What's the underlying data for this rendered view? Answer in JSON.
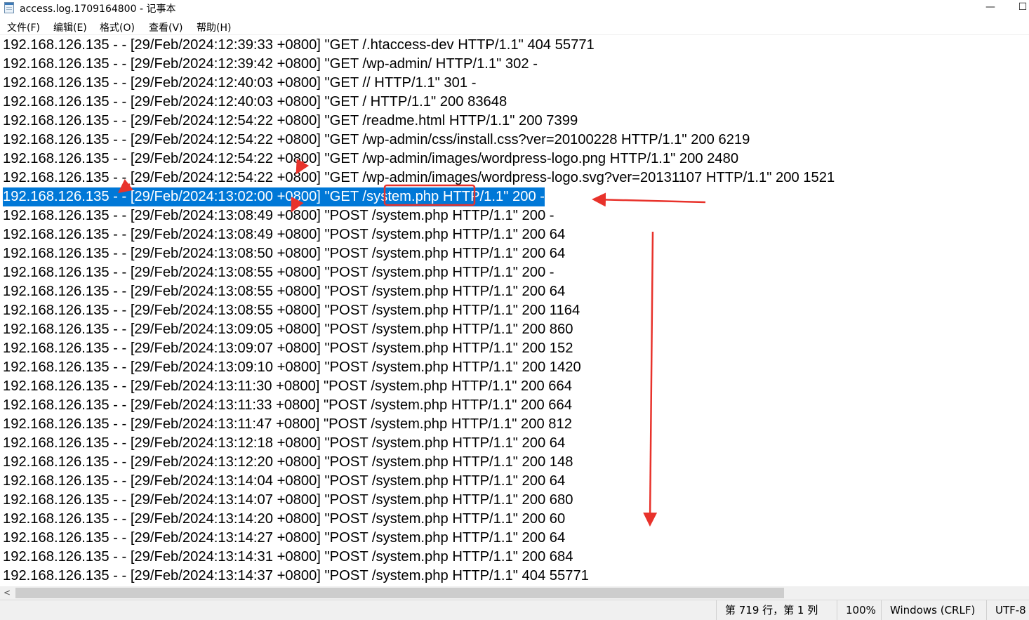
{
  "window": {
    "title": "access.log.1709164800 - 记事本",
    "minimize_label": "—",
    "maximize_label": "☐"
  },
  "menu": [
    "文件(F)",
    "编辑(E)",
    "格式(O)",
    "查看(V)",
    "帮助(H)"
  ],
  "lines": [
    "192.168.126.135 - - [29/Feb/2024:12:39:33 +0800] \"GET /.htaccess-dev HTTP/1.1\" 404 55771",
    "192.168.126.135 - - [29/Feb/2024:12:39:42 +0800] \"GET /wp-admin/ HTTP/1.1\" 302 -",
    "192.168.126.135 - - [29/Feb/2024:12:40:03 +0800] \"GET // HTTP/1.1\" 301 -",
    "192.168.126.135 - - [29/Feb/2024:12:40:03 +0800] \"GET / HTTP/1.1\" 200 83648",
    "192.168.126.135 - - [29/Feb/2024:12:54:22 +0800] \"GET /readme.html HTTP/1.1\" 200 7399",
    "192.168.126.135 - - [29/Feb/2024:12:54:22 +0800] \"GET /wp-admin/css/install.css?ver=20100228 HTTP/1.1\" 200 6219",
    "192.168.126.135 - - [29/Feb/2024:12:54:22 +0800] \"GET /wp-admin/images/wordpress-logo.png HTTP/1.1\" 200 2480",
    "192.168.126.135 - - [29/Feb/2024:12:54:22 +0800] \"GET /wp-admin/images/wordpress-logo.svg?ver=20131107 HTTP/1.1\" 200 1521",
    "192.168.126.135 - - [29/Feb/2024:13:02:00 +0800] \"GET /system.php HTTP/1.1\" 200 -",
    "192.168.126.135 - - [29/Feb/2024:13:08:49 +0800] \"POST /system.php HTTP/1.1\" 200 -",
    "192.168.126.135 - - [29/Feb/2024:13:08:49 +0800] \"POST /system.php HTTP/1.1\" 200 64",
    "192.168.126.135 - - [29/Feb/2024:13:08:50 +0800] \"POST /system.php HTTP/1.1\" 200 64",
    "192.168.126.135 - - [29/Feb/2024:13:08:55 +0800] \"POST /system.php HTTP/1.1\" 200 -",
    "192.168.126.135 - - [29/Feb/2024:13:08:55 +0800] \"POST /system.php HTTP/1.1\" 200 64",
    "192.168.126.135 - - [29/Feb/2024:13:08:55 +0800] \"POST /system.php HTTP/1.1\" 200 1164",
    "192.168.126.135 - - [29/Feb/2024:13:09:05 +0800] \"POST /system.php HTTP/1.1\" 200 860",
    "192.168.126.135 - - [29/Feb/2024:13:09:07 +0800] \"POST /system.php HTTP/1.1\" 200 152",
    "192.168.126.135 - - [29/Feb/2024:13:09:10 +0800] \"POST /system.php HTTP/1.1\" 200 1420",
    "192.168.126.135 - - [29/Feb/2024:13:11:30 +0800] \"POST /system.php HTTP/1.1\" 200 664",
    "192.168.126.135 - - [29/Feb/2024:13:11:33 +0800] \"POST /system.php HTTP/1.1\" 200 664",
    "192.168.126.135 - - [29/Feb/2024:13:11:47 +0800] \"POST /system.php HTTP/1.1\" 200 812",
    "192.168.126.135 - - [29/Feb/2024:13:12:18 +0800] \"POST /system.php HTTP/1.1\" 200 64",
    "192.168.126.135 - - [29/Feb/2024:13:12:20 +0800] \"POST /system.php HTTP/1.1\" 200 148",
    "192.168.126.135 - - [29/Feb/2024:13:14:04 +0800] \"POST /system.php HTTP/1.1\" 200 64",
    "192.168.126.135 - - [29/Feb/2024:13:14:07 +0800] \"POST /system.php HTTP/1.1\" 200 680",
    "192.168.126.135 - - [29/Feb/2024:13:14:20 +0800] \"POST /system.php HTTP/1.1\" 200 60",
    "192.168.126.135 - - [29/Feb/2024:13:14:27 +0800] \"POST /system.php HTTP/1.1\" 200 64",
    "192.168.126.135 - - [29/Feb/2024:13:14:31 +0800] \"POST /system.php HTTP/1.1\" 200 684",
    "192.168.126.135 - - [29/Feb/2024:13:14:37 +0800] \"POST /system.php HTTP/1.1\" 404 55771"
  ],
  "selected_line_index": 8,
  "horizontal_scroll": {
    "visible_fraction": 0.77,
    "left_arrow": "<"
  },
  "status": {
    "position": "第 719 行，第 1 列",
    "zoom": "100%",
    "line_ending": "Windows (CRLF)",
    "encoding": "UTF-8"
  },
  "colors": {
    "selection": "#0078d7",
    "annotation": "#e8322b",
    "status_bar": "#f0f0f0"
  }
}
